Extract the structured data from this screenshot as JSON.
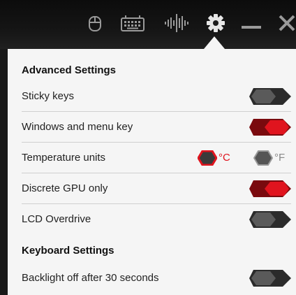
{
  "topbar": {
    "icons": [
      "mouse-icon",
      "keyboard-icon",
      "audio-equalizer-icon",
      "gear-icon",
      "minimize-icon",
      "close-icon"
    ]
  },
  "sections": {
    "advanced": "Advanced Settings",
    "keyboard": "Keyboard Settings"
  },
  "settings": {
    "sticky_keys": {
      "label": "Sticky keys",
      "enabled": false
    },
    "windows_menu_key": {
      "label": "Windows and menu key",
      "enabled": true
    },
    "temperature": {
      "label": "Temperature units",
      "celsius": "°C",
      "fahrenheit": "°F",
      "selected": "°C"
    },
    "discrete_gpu": {
      "label": "Discrete GPU only",
      "enabled": true
    },
    "lcd_overdrive": {
      "label": "LCD Overdrive",
      "enabled": false
    },
    "backlight_off": {
      "label": "Backlight off after 30 seconds",
      "enabled": false
    }
  },
  "colors": {
    "accent_red": "#e0141e",
    "off_gray": "#2b2b2b"
  }
}
